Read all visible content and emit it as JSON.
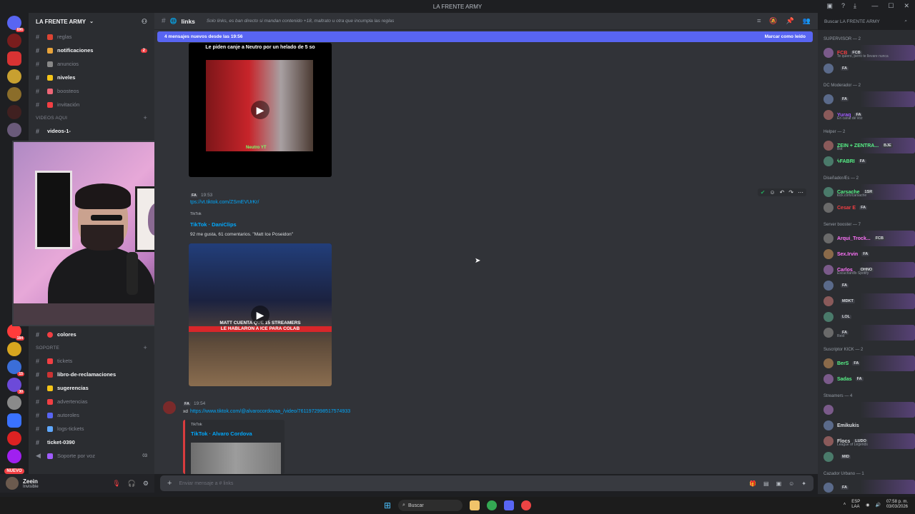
{
  "window": {
    "title": "LA FRENTE ARMY"
  },
  "server": {
    "name": "LA FRENTE ARMY"
  },
  "rail": {
    "badges": [
      "696",
      "184",
      "15",
      "30"
    ],
    "nuevo_label": "NUEVO"
  },
  "channels_top": [
    {
      "name": "reglas",
      "unread": false
    },
    {
      "name": "notificaciones",
      "unread": true,
      "mentions": "2"
    },
    {
      "name": "anuncios",
      "unread": false
    },
    {
      "name": "niveles",
      "unread": true
    },
    {
      "name": "boosteos",
      "unread": false
    },
    {
      "name": "invitación",
      "unread": false
    }
  ],
  "category_videos": "VIDEOS AQUI",
  "channel_videos": "videos-1-",
  "channel_colores": "colores",
  "category_soporte": "SOPORTE",
  "channels_soporte": [
    {
      "name": "tickets",
      "unread": false
    },
    {
      "name": "libro-de-reclamaciones",
      "unread": true
    },
    {
      "name": "sugerencias",
      "unread": true
    },
    {
      "name": "advertencias",
      "unread": false
    },
    {
      "name": "autoroles",
      "unread": false
    },
    {
      "name": "logs-tickets",
      "unread": false
    },
    {
      "name": "ticket-0390",
      "unread": true
    }
  ],
  "voice_channel": {
    "name": "Soporte por voz",
    "count": "03"
  },
  "user_panel": {
    "name": "Zeein",
    "status": "Invisible"
  },
  "channel_header": {
    "name": "links",
    "topic": "Solo links, es ban directo si mandan contenido +18, maltrato u otra que incumpla las reglas"
  },
  "search": {
    "placeholder": "Buscar LA FRENTE ARMY"
  },
  "new_messages_bar": {
    "text": "4 mensajes nuevos desde las 19:56",
    "action": "Marcar como leído"
  },
  "video1": {
    "caption": "Le piden canje a Neutro por un helado de 5 so",
    "tag": "Neutro YT"
  },
  "message2": {
    "time": "19:53",
    "role": "FA",
    "link": "tps://vt.tiktok.com/ZSmEVUrKr/",
    "embed_source": "TikTok",
    "embed_title": "TikTok · DaniClips",
    "embed_desc": "92 me gusta, 61 comentarios. \"Matt Ice Poseidon\""
  },
  "video2": {
    "caption_top": "MATT CUENTA QUE 15 STREAMERS",
    "caption_bottom": "LE HABLARON A ICE PARA COLAB"
  },
  "message3": {
    "time": "19:54",
    "role": "FA",
    "prefix": "xd",
    "link": "https://www.tiktok.com/@alvarocordovaa_/video/7611972998517574933",
    "embed_source": "TikTok",
    "embed_title": "TikTok · Alvaro Cordova"
  },
  "composer": {
    "placeholder": "Enviar mensaje a",
    "channel": "links"
  },
  "members": [
    {
      "category": "SUPERVISOR — 2",
      "users": [
        {
          "name": "FCB",
          "color": "#f23f43",
          "tag": "FCB",
          "sub": "Te quiero, perro te llevare nunca"
        },
        {
          "name": "",
          "color": "#f23f43",
          "tag": "FA"
        }
      ]
    },
    {
      "category": "DC Moderador — 2",
      "users": [
        {
          "name": "",
          "color": "#a05cff",
          "tag": "FA"
        },
        {
          "name": "Yuraq",
          "color": "#a05cff",
          "tag": "FA",
          "sub": "En canal de voz"
        }
      ]
    },
    {
      "category": "Helper — 2",
      "users": [
        {
          "name": "ZEIN + ZENTRA...",
          "color": "#57f287",
          "tag": "BJE",
          "sub": "Bot"
        },
        {
          "name": "ϟFABRI",
          "color": "#57f287",
          "tag": "FA"
        }
      ]
    },
    {
      "category": "DiseñadorÆs — 2",
      "users": [
        {
          "name": "Carsache",
          "color": "#57f287",
          "tag": "1SR",
          "sub": "kick.com/carsache"
        },
        {
          "name": "Cesar E",
          "color": "#f23f43",
          "tag": "FA"
        }
      ]
    },
    {
      "category": "Server booster — 7",
      "users": [
        {
          "name": "Arqui_Trock...",
          "color": "#ff73fa",
          "tag": "FCB"
        },
        {
          "name": "Sex.Irvin",
          "color": "#ff73fa",
          "tag": "FA"
        },
        {
          "name": "Carlos_",
          "color": "#ff73fa",
          "tag": "OHNO",
          "sub": "Escuchando Spotify"
        },
        {
          "name": "",
          "color": "#f23f43",
          "tag": "FA"
        },
        {
          "name": "",
          "color": "#a05cff",
          "tag": "MDKT"
        },
        {
          "name": "",
          "color": "#ff73fa",
          "tag": "LOL"
        },
        {
          "name": "",
          "color": "#ff73fa",
          "tag": "FA",
          "sub": "Rest"
        }
      ]
    },
    {
      "category": "Suscriptor KICK — 2",
      "users": [
        {
          "name": "BerS",
          "color": "#57f287",
          "tag": "FA"
        },
        {
          "name": "Sadas",
          "color": "#57f287",
          "tag": "FA"
        }
      ]
    },
    {
      "category": "Streamers — 4",
      "users": [
        {
          "name": "",
          "color": "#5865f2",
          "tag": ""
        },
        {
          "name": "Emikukis",
          "color": "#dbdee1",
          "tag": ""
        },
        {
          "name": "Flocs",
          "color": "#dbdee1",
          "tag": "LUDO",
          "sub": "League of Legends"
        },
        {
          "name": "",
          "color": "#ff73fa",
          "tag": "MID"
        }
      ]
    },
    {
      "category": "Cazador Urbano — 1",
      "users": [
        {
          "name": "",
          "color": "#a05cff",
          "tag": "FA"
        }
      ]
    }
  ],
  "taskbar": {
    "search": "Buscar",
    "lang": "ESP",
    "lang2": "LAA",
    "time": "07:58 p. m.",
    "date": "03/03/2026"
  }
}
